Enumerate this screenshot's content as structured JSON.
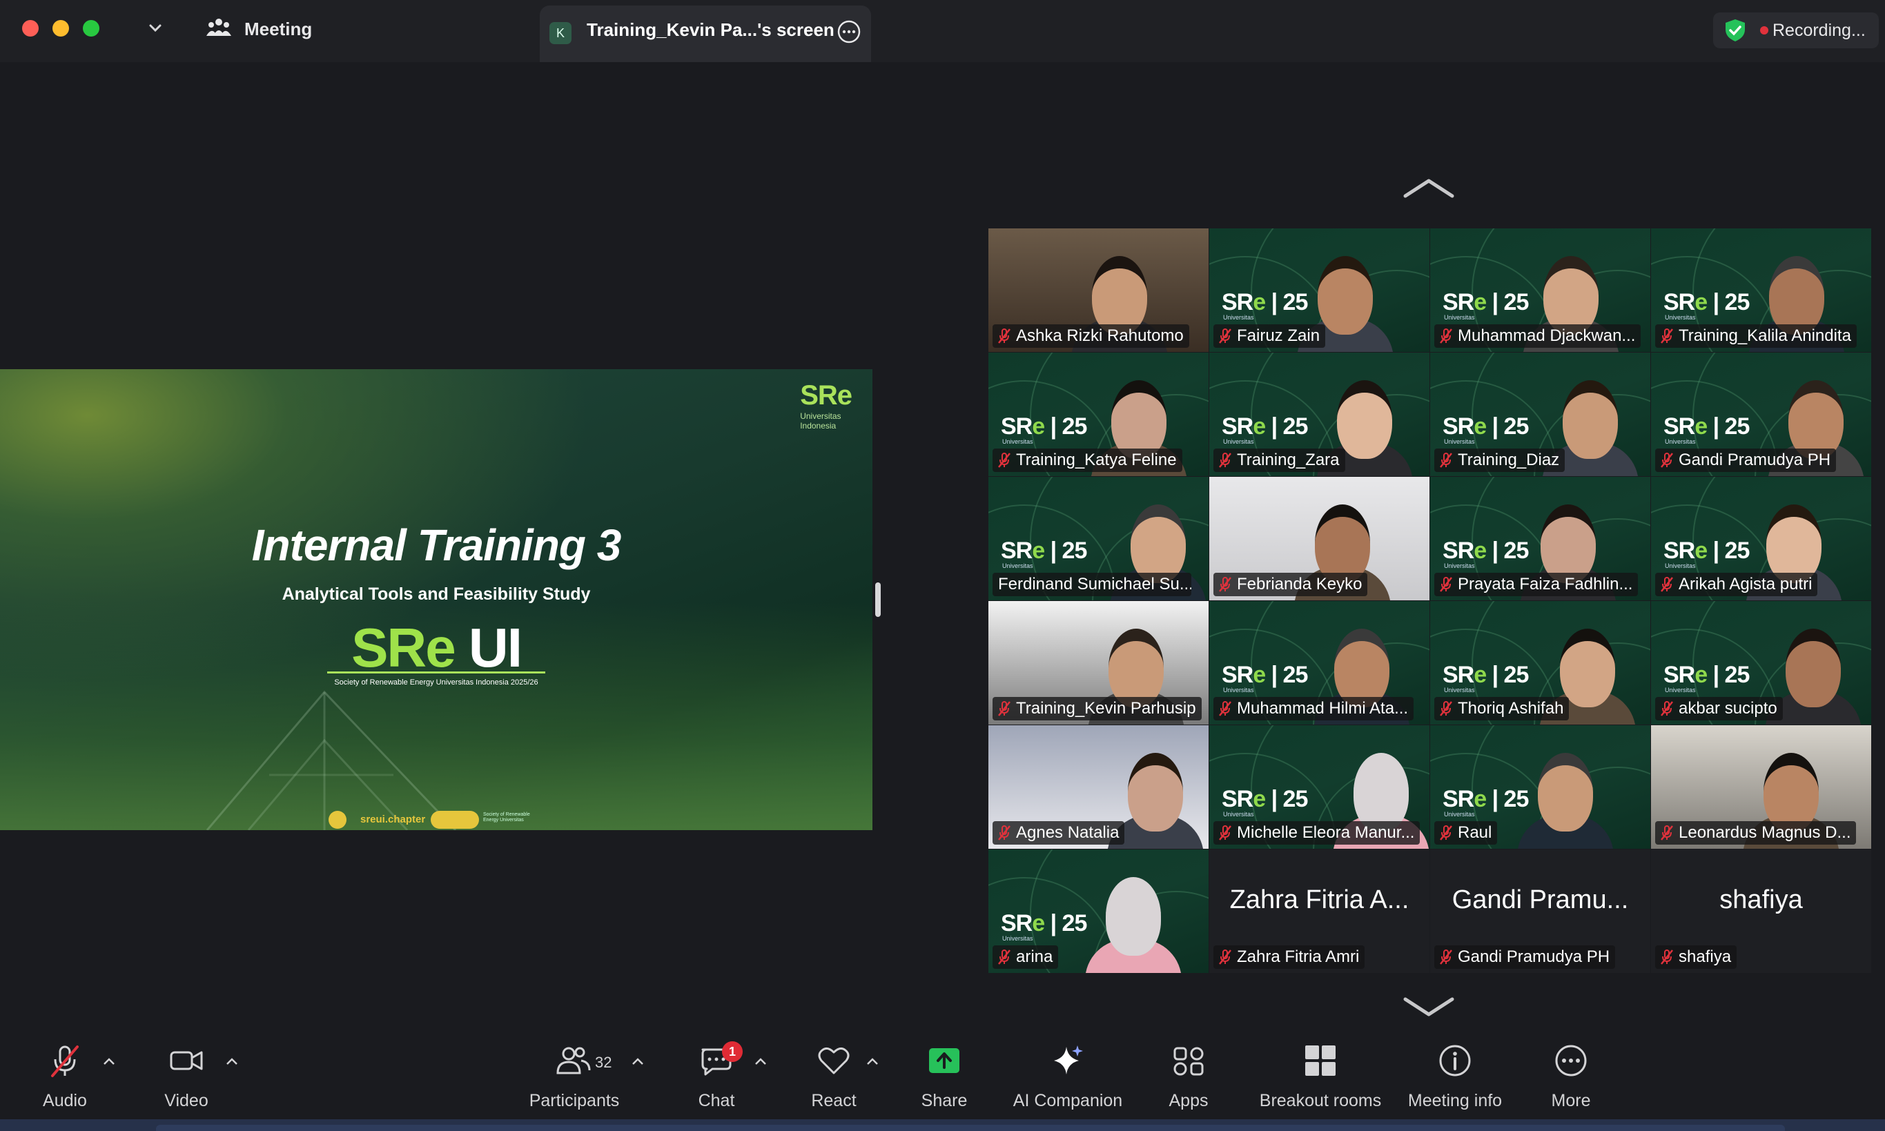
{
  "window": {
    "meeting_label": "Meeting",
    "tab_initial": "K",
    "tab_label": "Training_Kevin Pa...'s screen",
    "recording_label": "Recording..."
  },
  "slide": {
    "logo": "SRe",
    "logo_sub_1": "Universitas",
    "logo_sub_2": "Indonesia",
    "title": "Internal Training 3",
    "subtitle": "Analytical Tools and Feasibility Study",
    "brand_main": "SRe",
    "brand_suffix": "UI",
    "brand_caption": "Society of Renewable Energy Universitas Indonesia 2025/26",
    "footer_handle": "sreui.chapter",
    "footer_small_1": "Society of Renewable",
    "footer_small_2": "Energy Universitas"
  },
  "tile_brand": {
    "sre": "SR",
    "sre_e": "e",
    "year": "25",
    "sub": "Universitas"
  },
  "participants": [
    {
      "name": "Ashka Rizki Rahutomo",
      "muted": true
    },
    {
      "name": "Fairuz Zain",
      "muted": true
    },
    {
      "name": "Muhammad Djackwan...",
      "muted": true
    },
    {
      "name": "Training_Kalila Anindita",
      "muted": true
    },
    {
      "name": "Training_Katya Feline",
      "muted": true
    },
    {
      "name": "Training_Zara",
      "muted": true
    },
    {
      "name": "Training_Diaz",
      "muted": true
    },
    {
      "name": "Gandi Pramudya PH",
      "muted": true
    },
    {
      "name": "Ferdinand Sumichael Su...",
      "muted": false
    },
    {
      "name": "Febrianda Keyko",
      "muted": true
    },
    {
      "name": "Prayata Faiza Fadhlin...",
      "muted": true
    },
    {
      "name": "Arikah Agista putri",
      "muted": true
    },
    {
      "name": "Training_Kevin Parhusip",
      "muted": true
    },
    {
      "name": "Muhammad Hilmi Ata...",
      "muted": true
    },
    {
      "name": "Thoriq Ashifah",
      "muted": true
    },
    {
      "name": "akbar sucipto",
      "muted": true
    },
    {
      "name": "Agnes Natalia",
      "muted": true
    },
    {
      "name": "Michelle Eleora Manur...",
      "muted": true
    },
    {
      "name": "Raul",
      "muted": true
    },
    {
      "name": "Leonardus Magnus D...",
      "muted": true
    },
    {
      "name": "arina",
      "muted": true
    },
    {
      "name": "Zahra Fitria Amri",
      "muted": true,
      "display": "Zahra Fitria A..."
    },
    {
      "name": "Gandi Pramudya PH",
      "muted": true,
      "display": "Gandi Pramu..."
    },
    {
      "name": "shafiya",
      "muted": true,
      "display": "shafiya"
    }
  ],
  "toolbar": {
    "audio": "Audio",
    "video": "Video",
    "participants": "Participants",
    "participant_count": "32",
    "chat": "Chat",
    "chat_badge": "1",
    "react": "React",
    "share": "Share",
    "ai_companion": "AI Companion",
    "apps": "Apps",
    "breakout_rooms": "Breakout rooms",
    "meeting_info": "Meeting info",
    "more": "More"
  },
  "colors": {
    "accent_green": "#9fe24a",
    "share_green": "#27c15a",
    "mute_red": "#e0323c",
    "tile_bg": "#0f3a2a"
  }
}
